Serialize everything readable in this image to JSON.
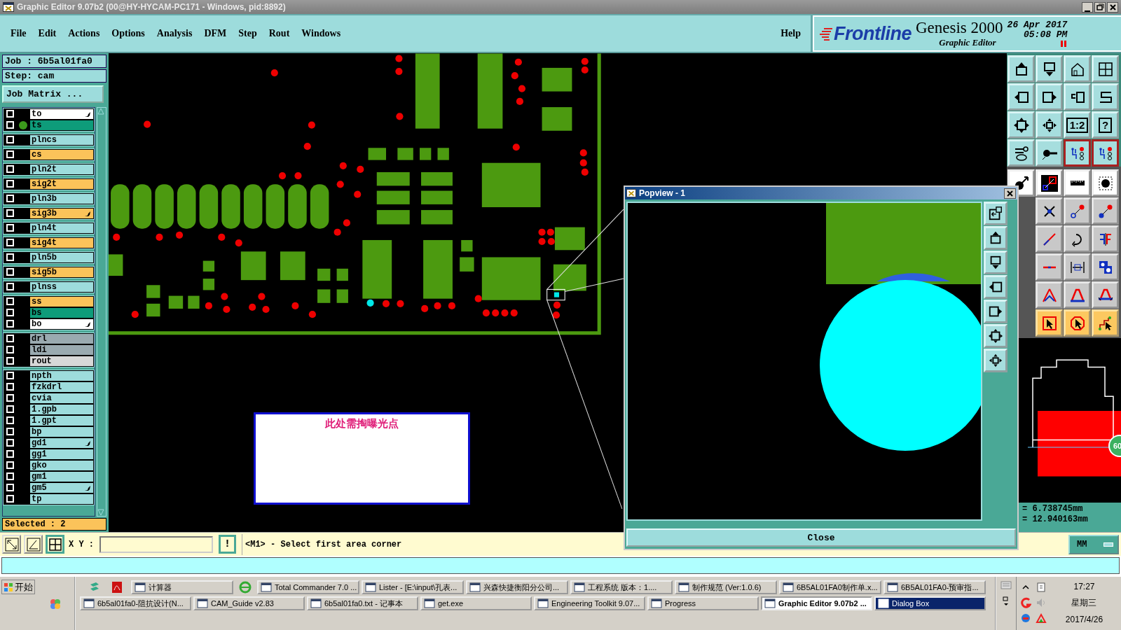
{
  "window": {
    "title": "Graphic Editor 9.07b2 (00@HY-HYCAM-PC171 - Windows, pid:8892)"
  },
  "menu": {
    "items": [
      "File",
      "Edit",
      "Actions",
      "Options",
      "Analysis",
      "DFM",
      "Step",
      "Rout",
      "Windows"
    ],
    "help": "Help"
  },
  "branding": {
    "logo": "Frontline",
    "product": "Genesis 2000",
    "subtitle": "Graphic Editor",
    "date": "26 Apr 2017",
    "time": "05:08 PM"
  },
  "job_panel": {
    "job": "Job : 6b5al01fa0",
    "step": "Step: cam",
    "matrix_button": "Job Matrix ...",
    "selected": "Selected : 2",
    "layer_groups": [
      {
        "layers": [
          {
            "name": "to",
            "color": "#ffffff",
            "checked": false,
            "marked": true,
            "shown": false
          },
          {
            "name": "ts",
            "color": "#0e9c7a",
            "checked": false,
            "marked": false,
            "shown": true
          }
        ]
      },
      {
        "layers": [
          {
            "name": "plncs",
            "color": "#9ddcdc",
            "checked": false,
            "marked": false,
            "shown": false
          }
        ]
      },
      {
        "layers": [
          {
            "name": "cs",
            "color": "#fbc35a",
            "checked": false,
            "marked": false,
            "shown": false
          }
        ]
      },
      {
        "layers": [
          {
            "name": "pln2t",
            "color": "#9ddcdc",
            "checked": false,
            "marked": false,
            "shown": false
          }
        ]
      },
      {
        "layers": [
          {
            "name": "sig2t",
            "color": "#fbc35a",
            "checked": false,
            "marked": false,
            "shown": false
          }
        ]
      },
      {
        "layers": [
          {
            "name": "pln3b",
            "color": "#9ddcdc",
            "checked": false,
            "marked": false,
            "shown": false
          }
        ]
      },
      {
        "layers": [
          {
            "name": "sig3b",
            "color": "#fbc35a",
            "checked": false,
            "marked": true,
            "shown": false
          }
        ]
      },
      {
        "layers": [
          {
            "name": "pln4t",
            "color": "#9ddcdc",
            "checked": false,
            "marked": false,
            "shown": false
          }
        ]
      },
      {
        "layers": [
          {
            "name": "sig4t",
            "color": "#fbc35a",
            "checked": false,
            "marked": false,
            "shown": false
          }
        ]
      },
      {
        "layers": [
          {
            "name": "pln5b",
            "color": "#9ddcdc",
            "checked": false,
            "marked": false,
            "shown": false
          }
        ]
      },
      {
        "layers": [
          {
            "name": "sig5b",
            "color": "#fbc35a",
            "checked": false,
            "marked": false,
            "shown": false
          }
        ]
      },
      {
        "layers": [
          {
            "name": "plnss",
            "color": "#9ddcdc",
            "checked": false,
            "marked": false,
            "shown": false
          }
        ]
      },
      {
        "layers": [
          {
            "name": "ss",
            "color": "#fbc35a",
            "checked": false,
            "marked": false,
            "shown": false
          },
          {
            "name": "bs",
            "color": "#0e9c7a",
            "checked": false,
            "marked": false,
            "shown": false
          },
          {
            "name": "bo",
            "color": "#ffffff",
            "checked": false,
            "marked": true,
            "shown": false
          }
        ]
      },
      {
        "layers": [
          {
            "name": "drl",
            "color": "#9aaab0",
            "checked": false,
            "marked": false,
            "shown": false
          },
          {
            "name": "ldi",
            "color": "#9aaab0",
            "checked": false,
            "marked": false,
            "shown": false
          },
          {
            "name": "rout",
            "color": "#d8d8d8",
            "checked": false,
            "marked": false,
            "shown": false
          }
        ]
      },
      {
        "layers": [
          {
            "name": "npth",
            "color": "#9ddcdc",
            "checked": false,
            "marked": false,
            "shown": false
          },
          {
            "name": "fzkdrl",
            "color": "#9ddcdc",
            "checked": false,
            "marked": false,
            "shown": false
          },
          {
            "name": "cvia",
            "color": "#9ddcdc",
            "checked": false,
            "marked": false,
            "shown": false
          },
          {
            "name": "1.gpb",
            "color": "#9ddcdc",
            "checked": false,
            "marked": false,
            "shown": false
          },
          {
            "name": "1.gpt",
            "color": "#9ddcdc",
            "checked": false,
            "marked": false,
            "shown": false
          },
          {
            "name": "bp",
            "color": "#9ddcdc",
            "checked": false,
            "marked": false,
            "shown": false
          },
          {
            "name": "gd1",
            "color": "#9ddcdc",
            "checked": false,
            "marked": true,
            "shown": false
          },
          {
            "name": "gg1",
            "color": "#9ddcdc",
            "checked": false,
            "marked": false,
            "shown": false
          },
          {
            "name": "gko",
            "color": "#9ddcdc",
            "checked": false,
            "marked": false,
            "shown": false
          },
          {
            "name": "gm1",
            "color": "#9ddcdc",
            "checked": false,
            "marked": false,
            "shown": false
          },
          {
            "name": "gm5",
            "color": "#9ddcdc",
            "checked": false,
            "marked": true,
            "shown": false
          },
          {
            "name": "tp",
            "color": "#9ddcdc",
            "checked": false,
            "marked": false,
            "shown": false
          }
        ]
      }
    ]
  },
  "canvas": {
    "note": "此处需掏曝光点"
  },
  "popview": {
    "title": "Popview - 1",
    "close_button": "Close"
  },
  "toolbar": {
    "scale_button": "1:2",
    "help_button": "?"
  },
  "readout": {
    "x": "= 6.738745mm",
    "y": "= 12.940163mm",
    "badge": "60",
    "units": "MM"
  },
  "command_line": {
    "xy_label": "X Y :",
    "alert_button": "!",
    "prompt": "<M1> - Select first area corner"
  },
  "taskbar": {
    "start": "开始",
    "row_1": [
      {
        "label": "计算器",
        "selected": false,
        "highlighted": false
      },
      {
        "label": "Total Commander 7.0 ...",
        "selected": false,
        "highlighted": false
      },
      {
        "label": "Lister - [E:\\input\\孔表...",
        "selected": false,
        "highlighted": false
      },
      {
        "label": "兴森快捷衡阳分公司...",
        "selected": false,
        "highlighted": false
      },
      {
        "label": "工程系统  版本：1....",
        "selected": false,
        "highlighted": false
      },
      {
        "label": "制作规范 (Ver:1.0.6)",
        "selected": false,
        "highlighted": false
      },
      {
        "label": "6B5AL01FA0制作单.x...",
        "selected": false,
        "highlighted": false
      },
      {
        "label": "6B5AL01FA0-预审指...",
        "selected": false,
        "highlighted": false
      }
    ],
    "row_2": [
      {
        "label": "6b5al01fa0-阻抗设计(N...",
        "selected": false,
        "highlighted": false
      },
      {
        "label": "CAM_Guide v2.83",
        "selected": false,
        "highlighted": false
      },
      {
        "label": "6b5al01fa0.txt - 记事本",
        "selected": false,
        "highlighted": false
      },
      {
        "label": "get.exe",
        "selected": false,
        "highlighted": false
      },
      {
        "label": "Engineering Toolkit 9.07...",
        "selected": false,
        "highlighted": false
      },
      {
        "label": "Progress",
        "selected": false,
        "highlighted": false
      },
      {
        "label": "Graphic Editor 9.07b2 ...",
        "selected": true,
        "highlighted": false
      },
      {
        "label": "Dialog Box",
        "selected": false,
        "highlighted": true
      }
    ],
    "clock": {
      "time": "17:27",
      "day": "星期三",
      "date": "2017/4/26"
    }
  }
}
